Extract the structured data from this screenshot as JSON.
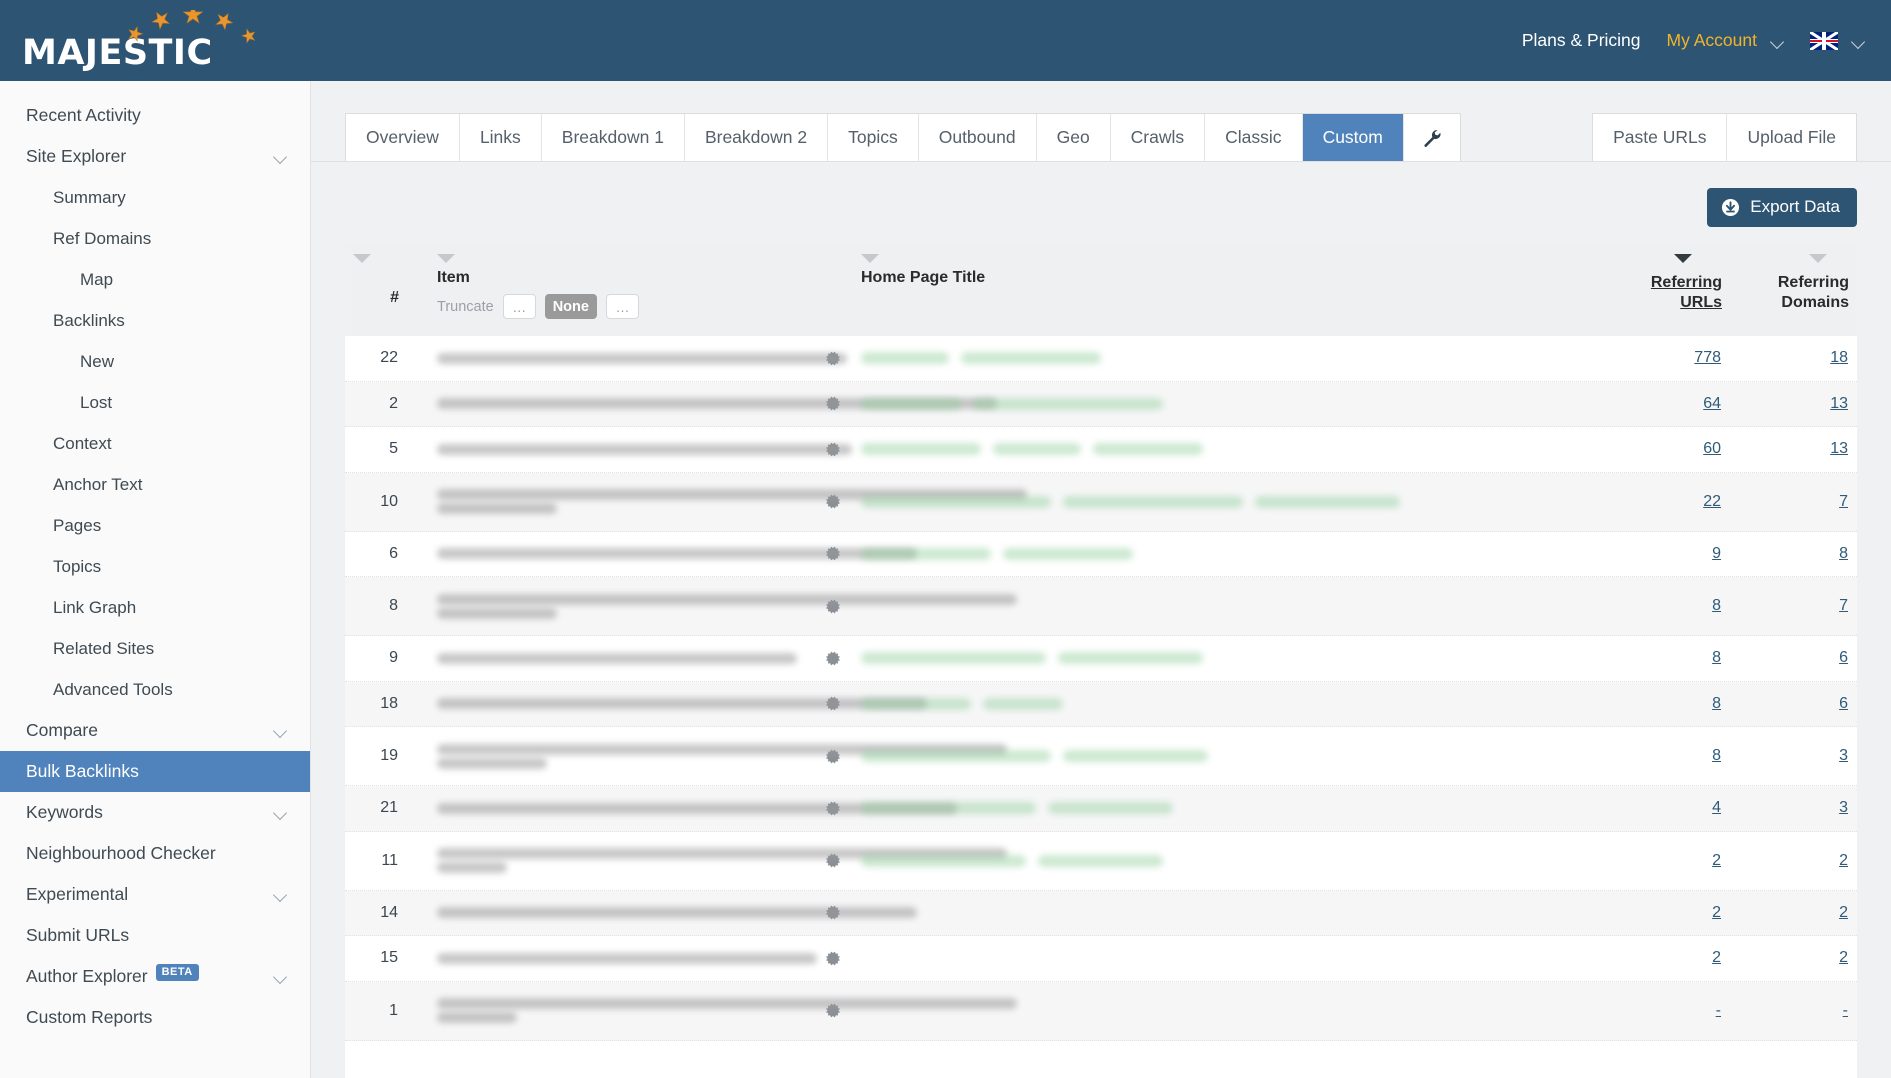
{
  "brand": {
    "name": "MAJESTIC",
    "star_color": "#e8962d"
  },
  "topbar": {
    "plans_label": "Plans & Pricing",
    "account_label": "My Account",
    "locale": "en-GB",
    "bg_color": "#2d5573",
    "accent_color": "#f0b429"
  },
  "sidebar": {
    "items": [
      {
        "label": "Recent Activity",
        "level": 0,
        "chevron": false,
        "active": false,
        "badge": ""
      },
      {
        "label": "Site Explorer",
        "level": 0,
        "chevron": true,
        "active": false,
        "badge": ""
      },
      {
        "label": "Summary",
        "level": 1,
        "chevron": false,
        "active": false,
        "badge": ""
      },
      {
        "label": "Ref Domains",
        "level": 1,
        "chevron": false,
        "active": false,
        "badge": ""
      },
      {
        "label": "Map",
        "level": 2,
        "chevron": false,
        "active": false,
        "badge": ""
      },
      {
        "label": "Backlinks",
        "level": 1,
        "chevron": false,
        "active": false,
        "badge": ""
      },
      {
        "label": "New",
        "level": 2,
        "chevron": false,
        "active": false,
        "badge": ""
      },
      {
        "label": "Lost",
        "level": 2,
        "chevron": false,
        "active": false,
        "badge": ""
      },
      {
        "label": "Context",
        "level": 1,
        "chevron": false,
        "active": false,
        "badge": ""
      },
      {
        "label": "Anchor Text",
        "level": 1,
        "chevron": false,
        "active": false,
        "badge": ""
      },
      {
        "label": "Pages",
        "level": 1,
        "chevron": false,
        "active": false,
        "badge": ""
      },
      {
        "label": "Topics",
        "level": 1,
        "chevron": false,
        "active": false,
        "badge": ""
      },
      {
        "label": "Link Graph",
        "level": 1,
        "chevron": false,
        "active": false,
        "badge": ""
      },
      {
        "label": "Related Sites",
        "level": 1,
        "chevron": false,
        "active": false,
        "badge": ""
      },
      {
        "label": "Advanced Tools",
        "level": 1,
        "chevron": false,
        "active": false,
        "badge": ""
      },
      {
        "label": "Compare",
        "level": 0,
        "chevron": true,
        "active": false,
        "badge": ""
      },
      {
        "label": "Bulk Backlinks",
        "level": 0,
        "chevron": false,
        "active": true,
        "badge": ""
      },
      {
        "label": "Keywords",
        "level": 0,
        "chevron": true,
        "active": false,
        "badge": ""
      },
      {
        "label": "Neighbourhood Checker",
        "level": 0,
        "chevron": false,
        "active": false,
        "badge": ""
      },
      {
        "label": "Experimental",
        "level": 0,
        "chevron": true,
        "active": false,
        "badge": ""
      },
      {
        "label": "Submit URLs",
        "level": 0,
        "chevron": false,
        "active": false,
        "badge": ""
      },
      {
        "label": "Author Explorer",
        "level": 0,
        "chevron": true,
        "active": false,
        "badge": "BETA"
      },
      {
        "label": "Custom Reports",
        "level": 0,
        "chevron": false,
        "active": false,
        "badge": ""
      }
    ],
    "active_color": "#5083bc"
  },
  "tabs": {
    "items": [
      {
        "label": "Overview",
        "active": false
      },
      {
        "label": "Links",
        "active": false
      },
      {
        "label": "Breakdown 1",
        "active": false
      },
      {
        "label": "Breakdown 2",
        "active": false
      },
      {
        "label": "Topics",
        "active": false
      },
      {
        "label": "Outbound",
        "active": false
      },
      {
        "label": "Geo",
        "active": false
      },
      {
        "label": "Crawls",
        "active": false
      },
      {
        "label": "Classic",
        "active": false
      },
      {
        "label": "Custom",
        "active": true
      }
    ],
    "settings_icon": "wrench-icon",
    "right_buttons": [
      {
        "label": "Paste URLs"
      },
      {
        "label": "Upload File"
      }
    ]
  },
  "toolbar": {
    "export_label": "Export Data",
    "export_icon": "download-icon",
    "export_color": "#2d5573"
  },
  "table": {
    "headers": {
      "num": "#",
      "item": "Item",
      "truncate_label": "Truncate",
      "truncate_options": [
        {
          "label": "…",
          "active": false
        },
        {
          "label": "None",
          "active": true
        },
        {
          "label": "…",
          "active": false
        }
      ],
      "home_page_title": "Home Page Title",
      "referring_urls_line1": "Referring",
      "referring_urls_line2": "URLs",
      "referring_domains_line1": "Referring",
      "referring_domains_line2": "Domains"
    },
    "sort": {
      "column": "Referring URLs",
      "direction": "desc"
    },
    "rows": [
      {
        "num": "22",
        "url_widths": [
          410
        ],
        "title_widths": [
          88,
          140
        ],
        "urls": "778",
        "domains": "18",
        "two_line": false
      },
      {
        "num": "2",
        "url_widths": [
          560
        ],
        "title_widths": [
          100,
          190
        ],
        "urls": "64",
        "domains": "13",
        "two_line": false
      },
      {
        "num": "5",
        "url_widths": [
          415
        ],
        "title_widths": [
          120,
          88,
          110
        ],
        "urls": "60",
        "domains": "13",
        "two_line": false
      },
      {
        "num": "10",
        "url_widths": [
          590,
          120
        ],
        "title_widths": [
          190,
          180,
          145
        ],
        "urls": "22",
        "domains": "7",
        "two_line": true
      },
      {
        "num": "6",
        "url_widths": [
          480
        ],
        "title_widths": [
          130,
          130
        ],
        "urls": "9",
        "domains": "8",
        "two_line": false
      },
      {
        "num": "8",
        "url_widths": [
          580,
          120
        ],
        "title_widths": [],
        "urls": "8",
        "domains": "7",
        "two_line": true
      },
      {
        "num": "9",
        "url_widths": [
          360
        ],
        "title_widths": [
          185,
          145
        ],
        "urls": "8",
        "domains": "6",
        "two_line": false
      },
      {
        "num": "18",
        "url_widths": [
          490
        ],
        "title_widths": [
          110,
          80
        ],
        "urls": "8",
        "domains": "6",
        "two_line": false
      },
      {
        "num": "19",
        "url_widths": [
          570,
          110
        ],
        "title_widths": [
          190,
          145
        ],
        "urls": "8",
        "domains": "3",
        "two_line": true
      },
      {
        "num": "21",
        "url_widths": [
          520
        ],
        "title_widths": [
          175,
          125
        ],
        "urls": "4",
        "domains": "3",
        "two_line": false
      },
      {
        "num": "11",
        "url_widths": [
          570,
          70
        ],
        "title_widths": [
          165,
          125
        ],
        "urls": "2",
        "domains": "2",
        "two_line": true
      },
      {
        "num": "14",
        "url_widths": [
          480
        ],
        "title_widths": [],
        "urls": "2",
        "domains": "2",
        "two_line": false
      },
      {
        "num": "15",
        "url_widths": [
          380
        ],
        "title_widths": [],
        "urls": "2",
        "domains": "2",
        "two_line": false
      },
      {
        "num": "1",
        "url_widths": [
          580,
          80
        ],
        "title_widths": [],
        "urls": "-",
        "domains": "-",
        "two_line": true
      }
    ]
  }
}
